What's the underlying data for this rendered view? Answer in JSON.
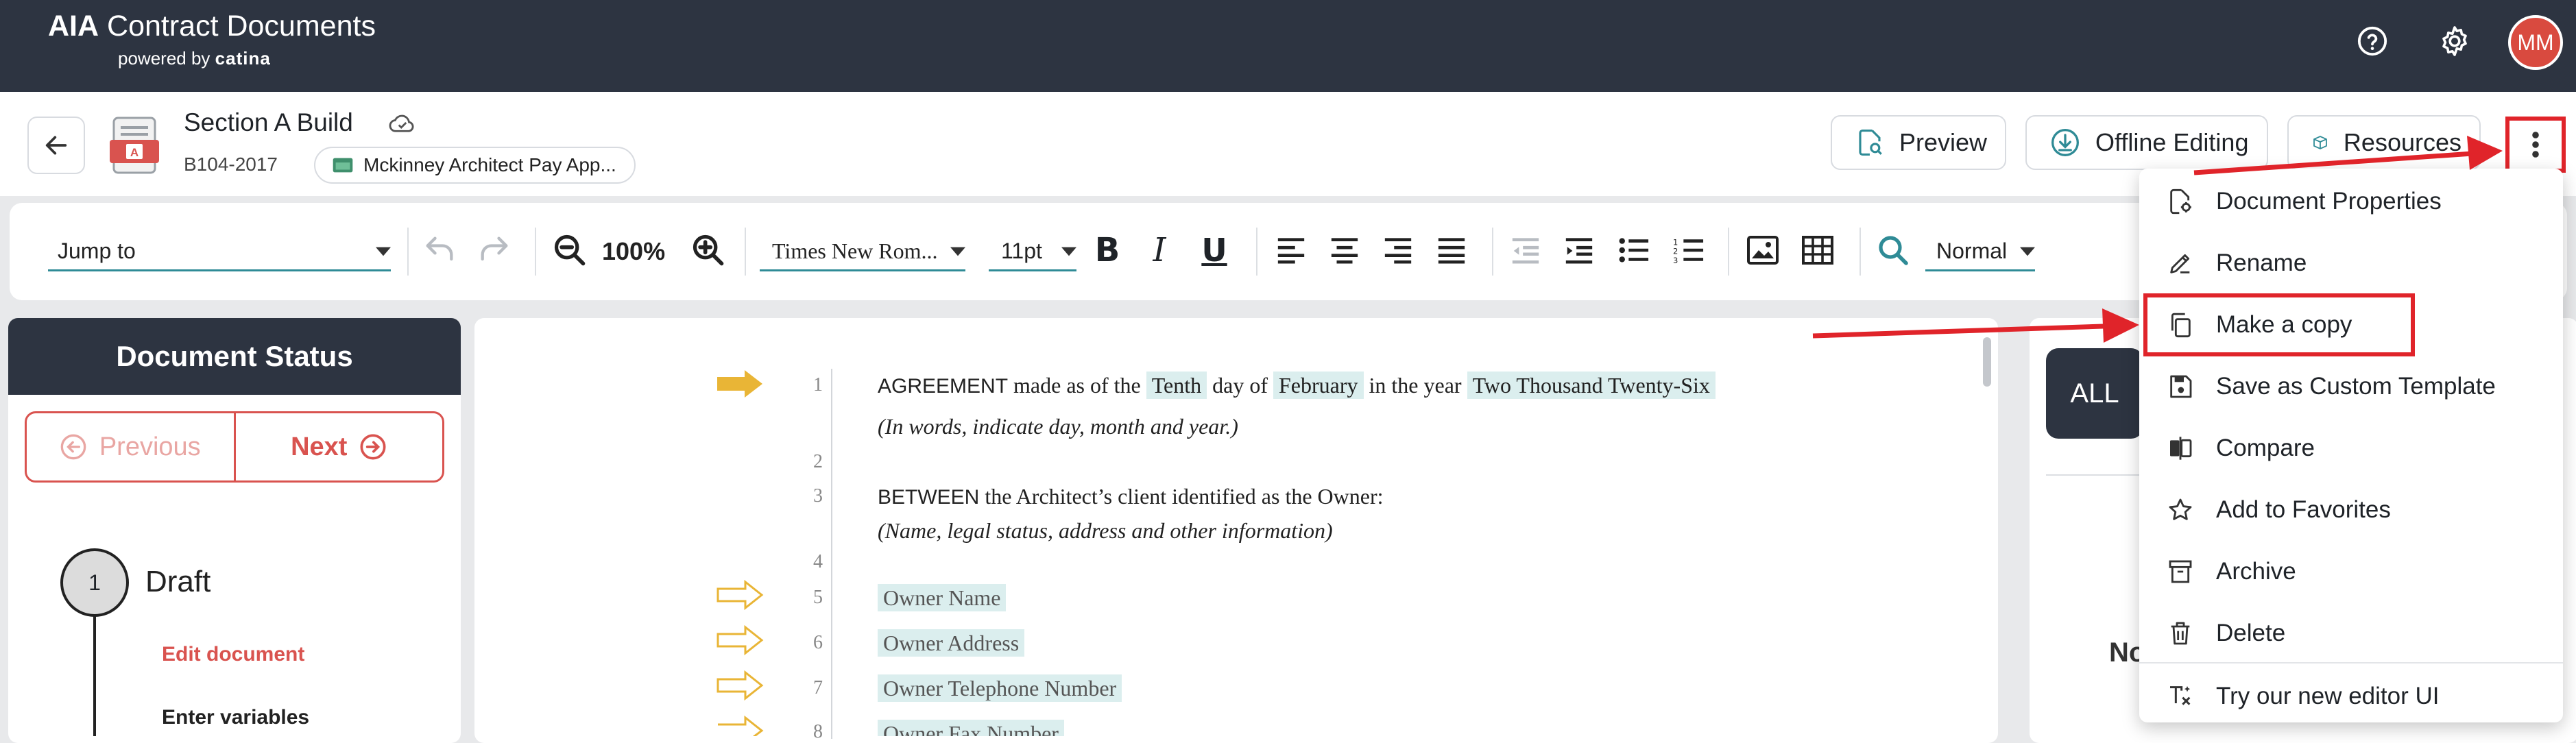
{
  "brand": {
    "name_bold": "AIA",
    "name_rest": " Contract Documents",
    "powered_prefix": "powered by ",
    "powered_brand": "catina"
  },
  "topbar": {
    "avatar_initials": "MM"
  },
  "document": {
    "title": "Section A Build",
    "code": "B104-2017",
    "project": "Mckinney Architect Pay App..."
  },
  "header_buttons": {
    "preview": "Preview",
    "offline": "Offline Editing",
    "resources": "Resources"
  },
  "toolbar": {
    "jump_to": "Jump to",
    "zoom": "100%",
    "font": "Times New Rom...",
    "size": "11pt",
    "style": "Normal"
  },
  "status_panel": {
    "title": "Document Status",
    "previous": "Previous",
    "next": "Next",
    "step_number": "1",
    "step_label": "Draft",
    "substeps": [
      "Edit document",
      "Enter variables"
    ]
  },
  "doc_lines": {
    "n1": "1",
    "n2": "2",
    "n3": "3",
    "n4": "4",
    "n5": "5",
    "n6": "6",
    "n7": "7",
    "n8": "8",
    "l1_a": "AGREEMENT",
    "l1_b": " made as of the ",
    "l1_day": "Tenth",
    "l1_c": " day of ",
    "l1_month": "February",
    "l1_d": " in the year ",
    "l1_year": "Two Thousand Twenty-Six",
    "l1_note": "(In words, indicate day, month and year.)",
    "l3_a": "BETWEEN",
    "l3_b": " the Architect’s client identified as the Owner:",
    "l3_note": "(Name, legal status, address and other information)",
    "l5": "Owner Name",
    "l6": "Owner Address",
    "l7": "Owner Telephone Number",
    "l8": "Owner Fax Number"
  },
  "right_panel": {
    "filter_all": "ALL",
    "partial": "No"
  },
  "menu": {
    "items": [
      {
        "label": "Document Properties",
        "icon": "document-settings-icon"
      },
      {
        "label": "Rename",
        "icon": "pencil-icon"
      },
      {
        "label": "Make a copy",
        "icon": "copy-icon"
      },
      {
        "label": "Save as Custom Template",
        "icon": "save-icon"
      },
      {
        "label": "Compare",
        "icon": "compare-icon"
      },
      {
        "label": "Add to Favorites",
        "icon": "star-icon"
      },
      {
        "label": "Archive",
        "icon": "archive-icon"
      },
      {
        "label": "Delete",
        "icon": "trash-icon"
      },
      {
        "label": "Try our new editor UI",
        "icon": "sparkle-icon"
      }
    ]
  },
  "colors": {
    "dark": "#2d3441",
    "accent_red": "#d9534f",
    "annotation_red": "#e0242a",
    "teal": "#2f8b96",
    "arrow_gold": "#e9b536"
  }
}
